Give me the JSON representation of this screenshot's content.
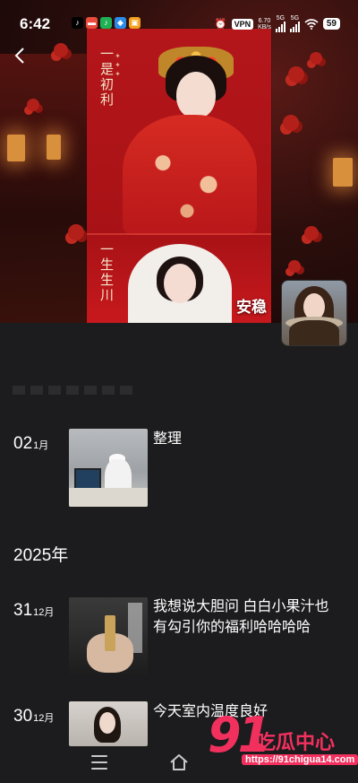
{
  "status_bar": {
    "time": "6:42",
    "vpn_label": "VPN",
    "network_speed": "6.70",
    "network_speed_unit": "KB/s",
    "signal_label_1": "5G",
    "signal_label_2": "5G",
    "battery": "59"
  },
  "profile": {
    "name": "安稳",
    "poster_text_top": "一是初利",
    "poster_text_bottom": "一生生川"
  },
  "timeline": {
    "entries": [
      {
        "day": "02",
        "month": "1月",
        "text": "整理"
      },
      {
        "day": "31",
        "month": "12月",
        "text": "我想说大胆问 白白小果汁也有勾引你的福利哈哈哈哈"
      },
      {
        "day": "30",
        "month": "12月",
        "text": "今天室内温度良好"
      }
    ],
    "year_marker": "2025年"
  },
  "watermark": {
    "number": "91",
    "name": "吃瓜中心",
    "url": "https://91chigua14.com"
  },
  "colors": {
    "background": "#1c1c1e",
    "watermark": "#f2305e"
  }
}
